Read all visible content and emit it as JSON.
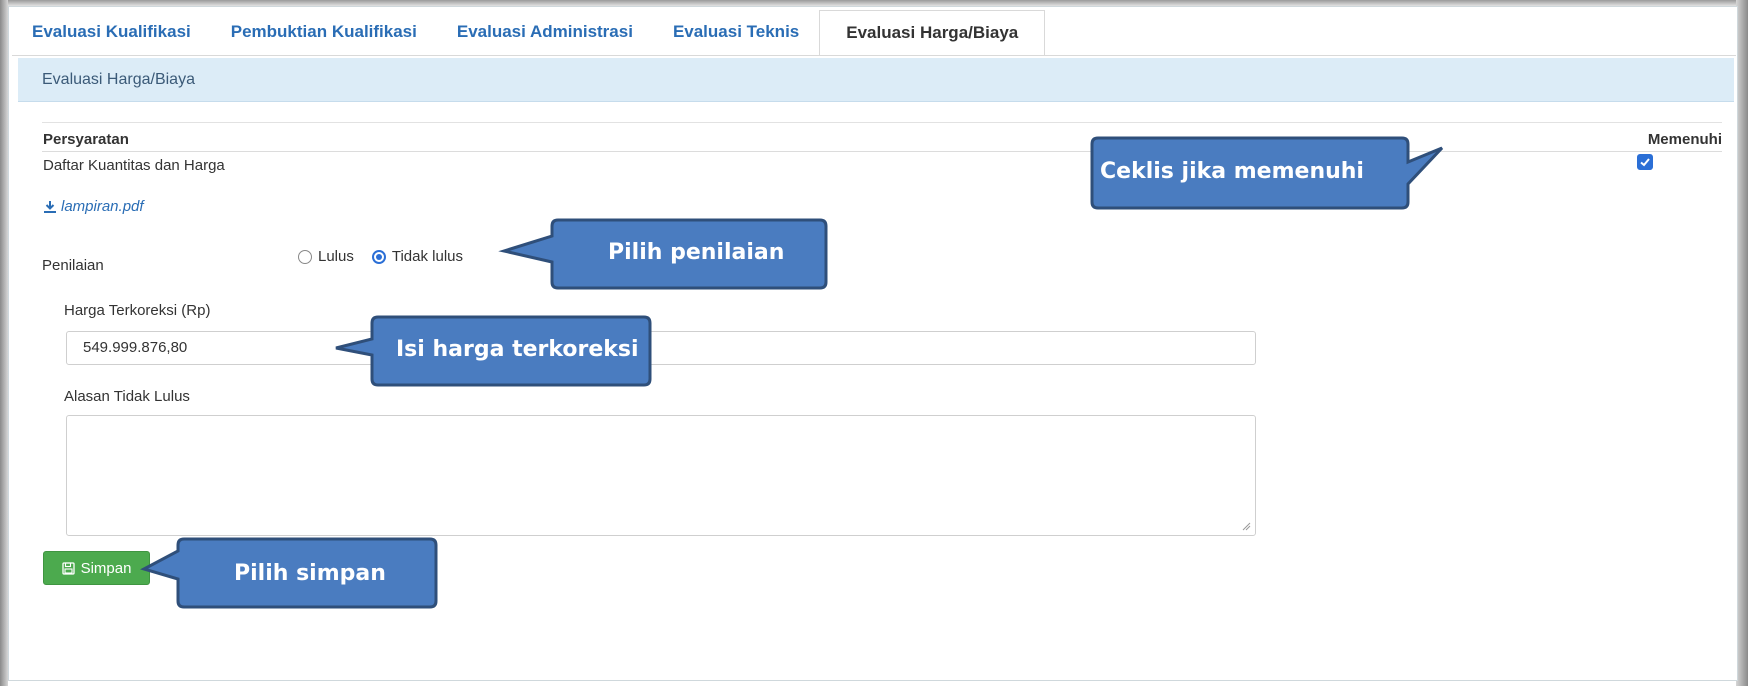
{
  "tabs": [
    {
      "label": "Evaluasi Kualifikasi",
      "active": false
    },
    {
      "label": "Pembuktian Kualifikasi",
      "active": false
    },
    {
      "label": "Evaluasi Administrasi",
      "active": false
    },
    {
      "label": "Evaluasi Teknis",
      "active": false
    },
    {
      "label": "Evaluasi Harga/Biaya",
      "active": true
    }
  ],
  "panel": {
    "title": "Evaluasi Harga/Biaya"
  },
  "table": {
    "header_requirement": "Persyaratan",
    "header_fulfilled": "Memenuhi",
    "rows": [
      {
        "item": "Daftar Kuantitas dan Harga",
        "fulfilled": true
      }
    ]
  },
  "attachment": {
    "label": "lampiran.pdf"
  },
  "penilaian": {
    "label": "Penilaian",
    "options": [
      "Lulus",
      "Tidak lulus"
    ],
    "selected": "Tidak lulus"
  },
  "harga": {
    "label": "Harga Terkoreksi (Rp)",
    "value": "549.999.876,80"
  },
  "alasan": {
    "label": "Alasan Tidak Lulus",
    "value": ""
  },
  "save_button": {
    "label": "Simpan"
  },
  "callouts": {
    "checkbox": "Ceklis jika memenuhi",
    "penilaian": "Pilih penilaian",
    "harga": "Isi harga terkoreksi",
    "simpan": "Pilih simpan"
  },
  "colors": {
    "link": "#2a6db5",
    "panel_header_bg": "#dcecf7",
    "callout_fill": "#4a7cc0",
    "callout_border": "#2f4f7a",
    "save_button": "#4caa4e",
    "checkbox": "#2b6fd6"
  },
  "icons": {
    "attachment": "download-icon",
    "save": "floppy-disk-icon",
    "checkbox": "checkmark-icon"
  }
}
